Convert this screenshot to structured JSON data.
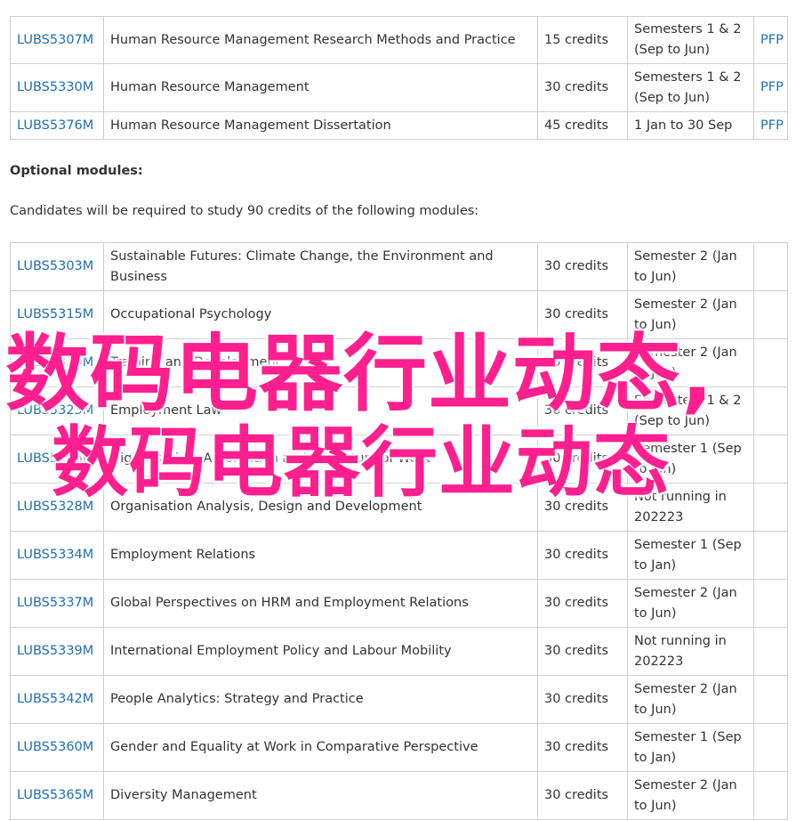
{
  "core_modules": [
    {
      "code": "LUBS5307M",
      "title": "Human Resource Management Research Methods and Practice",
      "credits": "15 credits",
      "semester_line1": "Semesters 1 & 2",
      "semester_line2": "(Sep to Jun)",
      "pfp": "PFP"
    },
    {
      "code": "LUBS5330M",
      "title": "Human Resource Management",
      "credits": "30 credits",
      "semester_line1": "Semesters 1 & 2",
      "semester_line2": "(Sep to Jun)",
      "pfp": "PFP"
    },
    {
      "code": "LUBS5376M",
      "title": "Human Resource Management Dissertation",
      "credits": "45 credits",
      "semester_line1": "1 Jan to 30 Sep",
      "semester_line2": "",
      "pfp": "PFP"
    }
  ],
  "optional_heading": "Optional modules:",
  "optional_instructions": "Candidates will be required to study 90 credits of the following modules:",
  "optional_modules": [
    {
      "code": "LUBS5303M",
      "title_line1": "Sustainable Futures: Climate Change, the Environment and",
      "title_line2": "Business",
      "credits": "30 credits",
      "semester_line1": "Semester 2 (Jan",
      "semester_line2": "to Jun)"
    },
    {
      "code": "LUBS5315M",
      "title_line1": "Occupational Psychology",
      "title_line2": "",
      "credits": "30 credits",
      "semester_line1": "Semester 2 (Jan",
      "semester_line2": "to Jun)"
    },
    {
      "code": "LUBS5320M",
      "title_line1": "Training and Development",
      "title_line2": "",
      "credits": "30 credits",
      "semester_line1": "Semester 2 (Jan",
      "semester_line2": "to Jun)"
    },
    {
      "code": "LUBS5323M",
      "title_line1": "Employment Law",
      "title_line2": "",
      "credits": "30 credits",
      "semester_line1": "Semesters 1 & 2",
      "semester_line2": "(Sep to Jun)"
    },
    {
      "code": "LUBS5326M",
      "title_line1": "Digitalisation, Automation and the Future of Work",
      "title_line2": "",
      "credits": "30 credits",
      "semester_line1": "Semester 1 (Sep",
      "semester_line2": "to Jan)"
    },
    {
      "code": "LUBS5328M",
      "title_line1": "Organisation Analysis, Design and Development",
      "title_line2": "",
      "credits": "30 credits",
      "semester_line1": "Not running in",
      "semester_line2": "202223"
    },
    {
      "code": "LUBS5334M",
      "title_line1": "Employment Relations",
      "title_line2": "",
      "credits": "30 credits",
      "semester_line1": "Semester 1 (Sep",
      "semester_line2": "to Jan)"
    },
    {
      "code": "LUBS5337M",
      "title_line1": "Global Perspectives on HRM and Employment Relations",
      "title_line2": "",
      "credits": "30 credits",
      "semester_line1": "Semester 2 (Jan",
      "semester_line2": "to Jun)"
    },
    {
      "code": "LUBS5339M",
      "title_line1": "International Employment Policy and Labour Mobility",
      "title_line2": "",
      "credits": "30 credits",
      "semester_line1": "Not running in",
      "semester_line2": "202223"
    },
    {
      "code": "LUBS5342M",
      "title_line1": "People Analytics: Strategy and Practice",
      "title_line2": "",
      "credits": "30 credits",
      "semester_line1": "Semester 2 (Jan",
      "semester_line2": "to Jun)"
    },
    {
      "code": "LUBS5360M",
      "title_line1": "Gender and Equality at Work in Comparative Perspective",
      "title_line2": "",
      "credits": "30 credits",
      "semester_line1": "Semester 1 (Sep",
      "semester_line2": "to Jan)"
    },
    {
      "code": "LUBS5365M",
      "title_line1": "Diversity Management",
      "title_line2": "",
      "credits": "30 credits",
      "semester_line1": "Semester 2 (Jan",
      "semester_line2": "to Jun)"
    }
  ],
  "overlay_text_1": "数码电器行业动态,",
  "overlay_text_2": "数码电器行业动态",
  "colors": {
    "link": "#1f6fb2",
    "overlay": "#ff1f8f",
    "border": "#cfcfcf",
    "text": "#333333"
  }
}
